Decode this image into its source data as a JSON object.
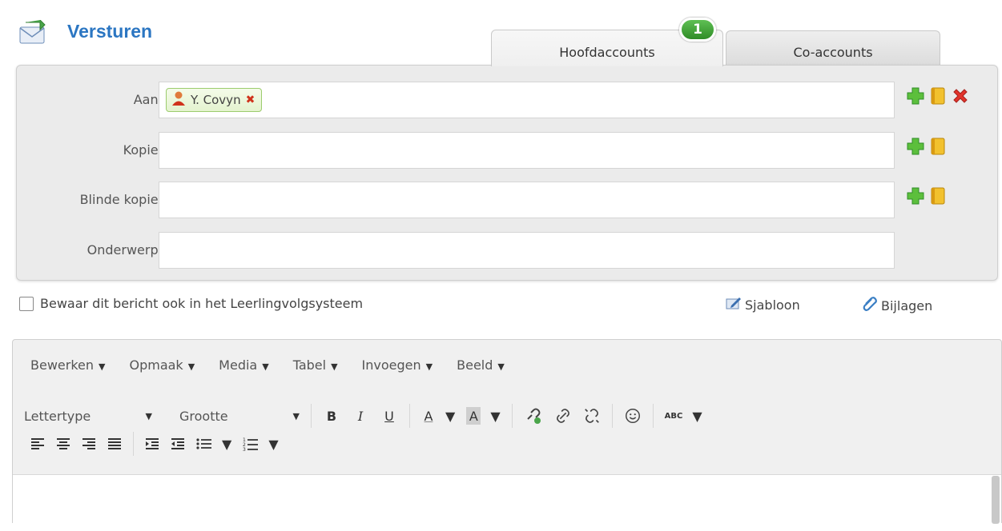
{
  "header": {
    "title": "Versturen",
    "icon": "envelope-send-icon"
  },
  "tabs": [
    {
      "label": "Hoofdaccounts",
      "active": true
    },
    {
      "label": "Co-accounts",
      "active": false
    }
  ],
  "badge": {
    "count": "1"
  },
  "form": {
    "to_label": "Aan:",
    "recipient": "Y. Covyn",
    "cc_label": "Kopie:",
    "bcc_label": "Blinde kopie:",
    "subject_label": "Onderwerp:"
  },
  "options": {
    "save_label": "Bewaar dit bericht ook in het Leerlingvolgsysteem",
    "template_label": "Sjabloon",
    "attachments_label": "Bijlagen"
  },
  "editor": {
    "menus": [
      "Bewerken",
      "Opmaak",
      "Media",
      "Tabel",
      "Invoegen",
      "Beeld"
    ],
    "font_family": "Lettertype",
    "font_size": "Grootte",
    "bold": "B",
    "italic": "I",
    "underline": "U",
    "text_color": "A",
    "bg_color": "A",
    "spellcheck": "ABC"
  },
  "colors": {
    "accent": "#2b76c2",
    "badge": "#3a9a31"
  }
}
